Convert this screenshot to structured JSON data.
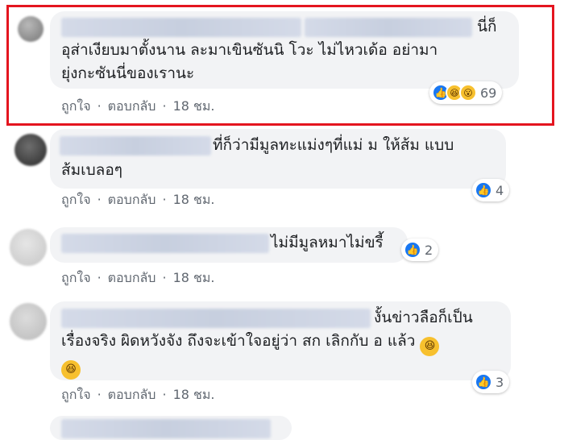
{
  "comments": [
    {
      "line1": "นี่ก็",
      "line2": "อุส่าเงียบมาตั้งนาน ละมาเขินซันนิ โวะ ไม่ไหวเด้อ อย่ามา",
      "line3": "ยุ่งกะซันนี่ของเรานะ",
      "like_label": "ถูกใจ",
      "reply_label": "ตอบกลับ",
      "time": "18 ชม.",
      "reaction_icons": [
        "like-icon",
        "haha-icon",
        "wow-icon"
      ],
      "reaction_count": "69"
    },
    {
      "line1": "ที่ก็ว่ามีมูลทะแม่งๆที่แม่ ม ให้ส้ม แบบ",
      "line2": "ส้มเบลอๆ",
      "like_label": "ถูกใจ",
      "reply_label": "ตอบกลับ",
      "time": "18 ชม.",
      "reaction_icons": [
        "like-icon"
      ],
      "reaction_count": "4"
    },
    {
      "line1": "ไม่มีมูลหมาไม่ขรี้",
      "like_label": "ถูกใจ",
      "reply_label": "ตอบกลับ",
      "time": "18 ชม.",
      "reaction_icons": [
        "like-icon"
      ],
      "reaction_count": "2"
    },
    {
      "line1": "งั้นข่าวลือก็เป็น",
      "line2": "เรื่องจริง ผิดหวังจัง ถึงจะเข้าใจอยู่ว่า สก เลิกกับ อ แล้ว",
      "like_label": "ถูกใจ",
      "reply_label": "ตอบกลับ",
      "time": "18 ชม.",
      "reaction_icons": [
        "like-icon"
      ],
      "reaction_count": "3"
    }
  ],
  "separator": "·",
  "colors": {
    "highlight_border": "#e4151f",
    "bubble": "#f2f3f5",
    "like_blue": "#1877f2",
    "meta_text": "#606770"
  }
}
